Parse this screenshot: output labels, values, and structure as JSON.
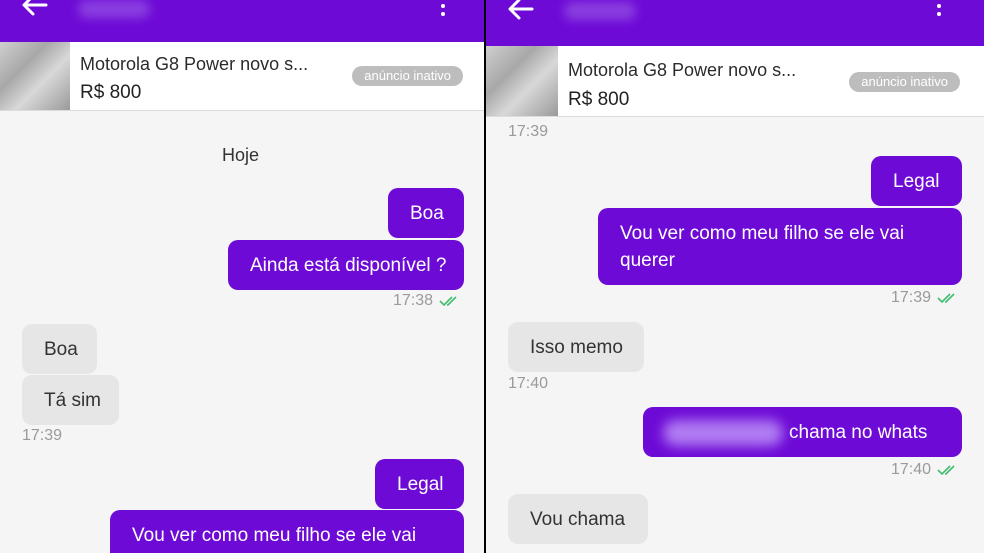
{
  "colors": {
    "accent": "#6e0ad6",
    "incoming": "#e6e6e6",
    "ticks": "#3dbd6e"
  },
  "left": {
    "ad": {
      "title": "Motorola G8 Power novo s...",
      "price": "R$ 800",
      "status": "anúncio inativo"
    },
    "date_label": "Hoje",
    "messages": [
      {
        "text": "Boa"
      },
      {
        "text": "Ainda está disponível ?"
      },
      {
        "time": "17:38"
      },
      {
        "text": "Boa"
      },
      {
        "text": "Tá sim"
      },
      {
        "time": "17:39"
      },
      {
        "text": "Legal"
      },
      {
        "text": "Vou ver como meu filho se ele vai"
      }
    ]
  },
  "right": {
    "ad": {
      "title": "Motorola G8 Power novo s...",
      "price": "R$ 800",
      "status": "anúncio inativo"
    },
    "top_time": "17:39",
    "messages": [
      {
        "text": "Legal"
      },
      {
        "text_line1": "Vou ver como meu filho se ele vai",
        "text_line2": "querer"
      },
      {
        "time": "17:39"
      },
      {
        "text": "Isso memo"
      },
      {
        "time": "17:40"
      },
      {
        "text": "chama no whats"
      },
      {
        "time": "17:40"
      },
      {
        "text": "Vou chama"
      }
    ]
  }
}
